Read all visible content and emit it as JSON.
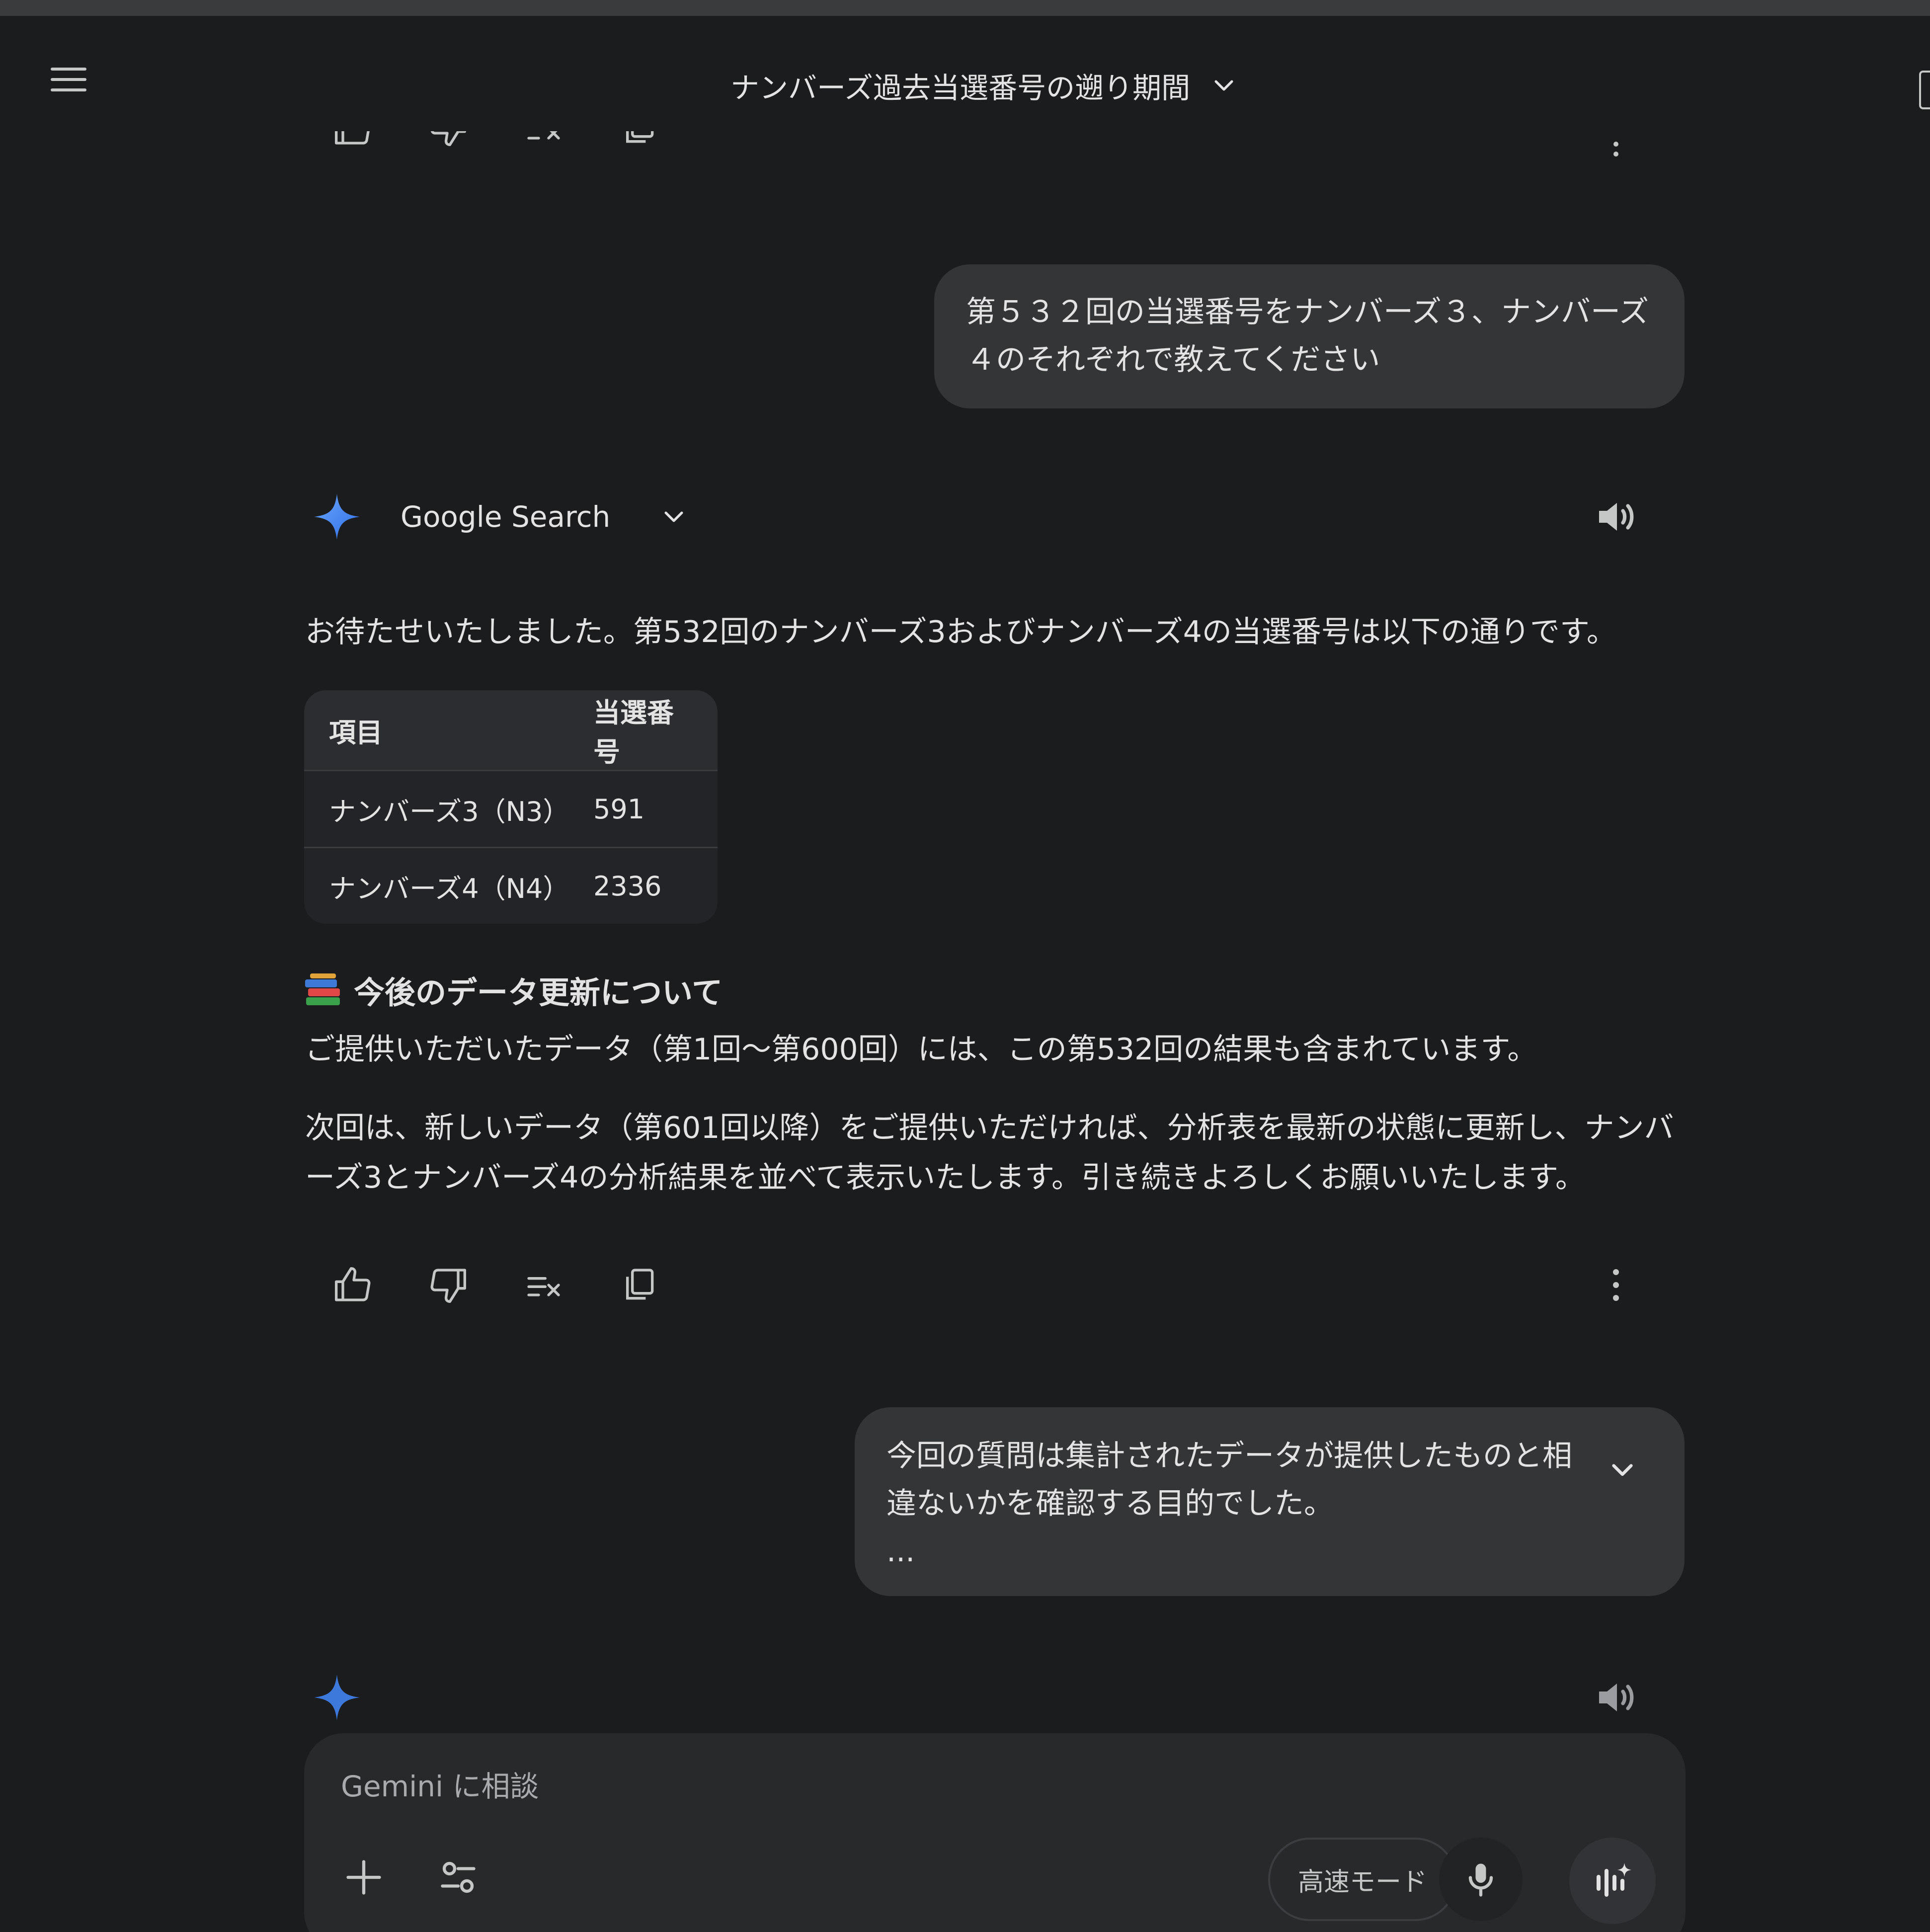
{
  "header": {
    "title": "ナンバーズ過去当選番号の遡り期間"
  },
  "messages": {
    "user1": {
      "line1": "第５３２回の当選番号をナンバーズ３、ナンバーズ",
      "line2": "４のそれぞれで教えてください"
    },
    "model": {
      "source_label": "Google Search",
      "intro": "お待たせいたしました。第532回のナンバーズ3およびナンバーズ4の当選番号は以下の通りです。",
      "table": {
        "headers": [
          "項目",
          "当選番号"
        ],
        "rows": [
          [
            "ナンバーズ3（N3）",
            "591"
          ],
          [
            "ナンバーズ4（N4）",
            "2336"
          ]
        ]
      },
      "heading": "今後のデータ更新について",
      "para1": "ご提供いただいたデータ（第1回〜第600回）には、この第532回の結果も含まれています。",
      "para2_line1": "次回は、新しいデータ（第601回以降）をご提供いただければ、分析表を最新の状態に更新し、ナンバ",
      "para2_line2": "ーズ3とナンバーズ4の分析結果を並べて表示いたします。引き続きよろしくお願いいたします。"
    },
    "user2": {
      "line1": "今回の質問は集計されたデータが提供したものと相",
      "line2": "違ないかを確認する目的でした。",
      "line3": "..."
    }
  },
  "input": {
    "placeholder": "Gemini に相談",
    "mode_label": "高速モード"
  },
  "icons": [
    "menu-icon",
    "chevron-down-icon",
    "thumbs-up-icon",
    "thumbs-down-icon",
    "modify-response-icon",
    "copy-icon",
    "more-vert-icon",
    "gemini-spark-icon",
    "speaker-icon",
    "books-icon",
    "plus-icon",
    "tools-icon",
    "mic-icon",
    "live-icon"
  ],
  "colors": {
    "background": "#1b1c1e",
    "bubble": "#333537",
    "gemini_blue": "#4c8df6"
  }
}
